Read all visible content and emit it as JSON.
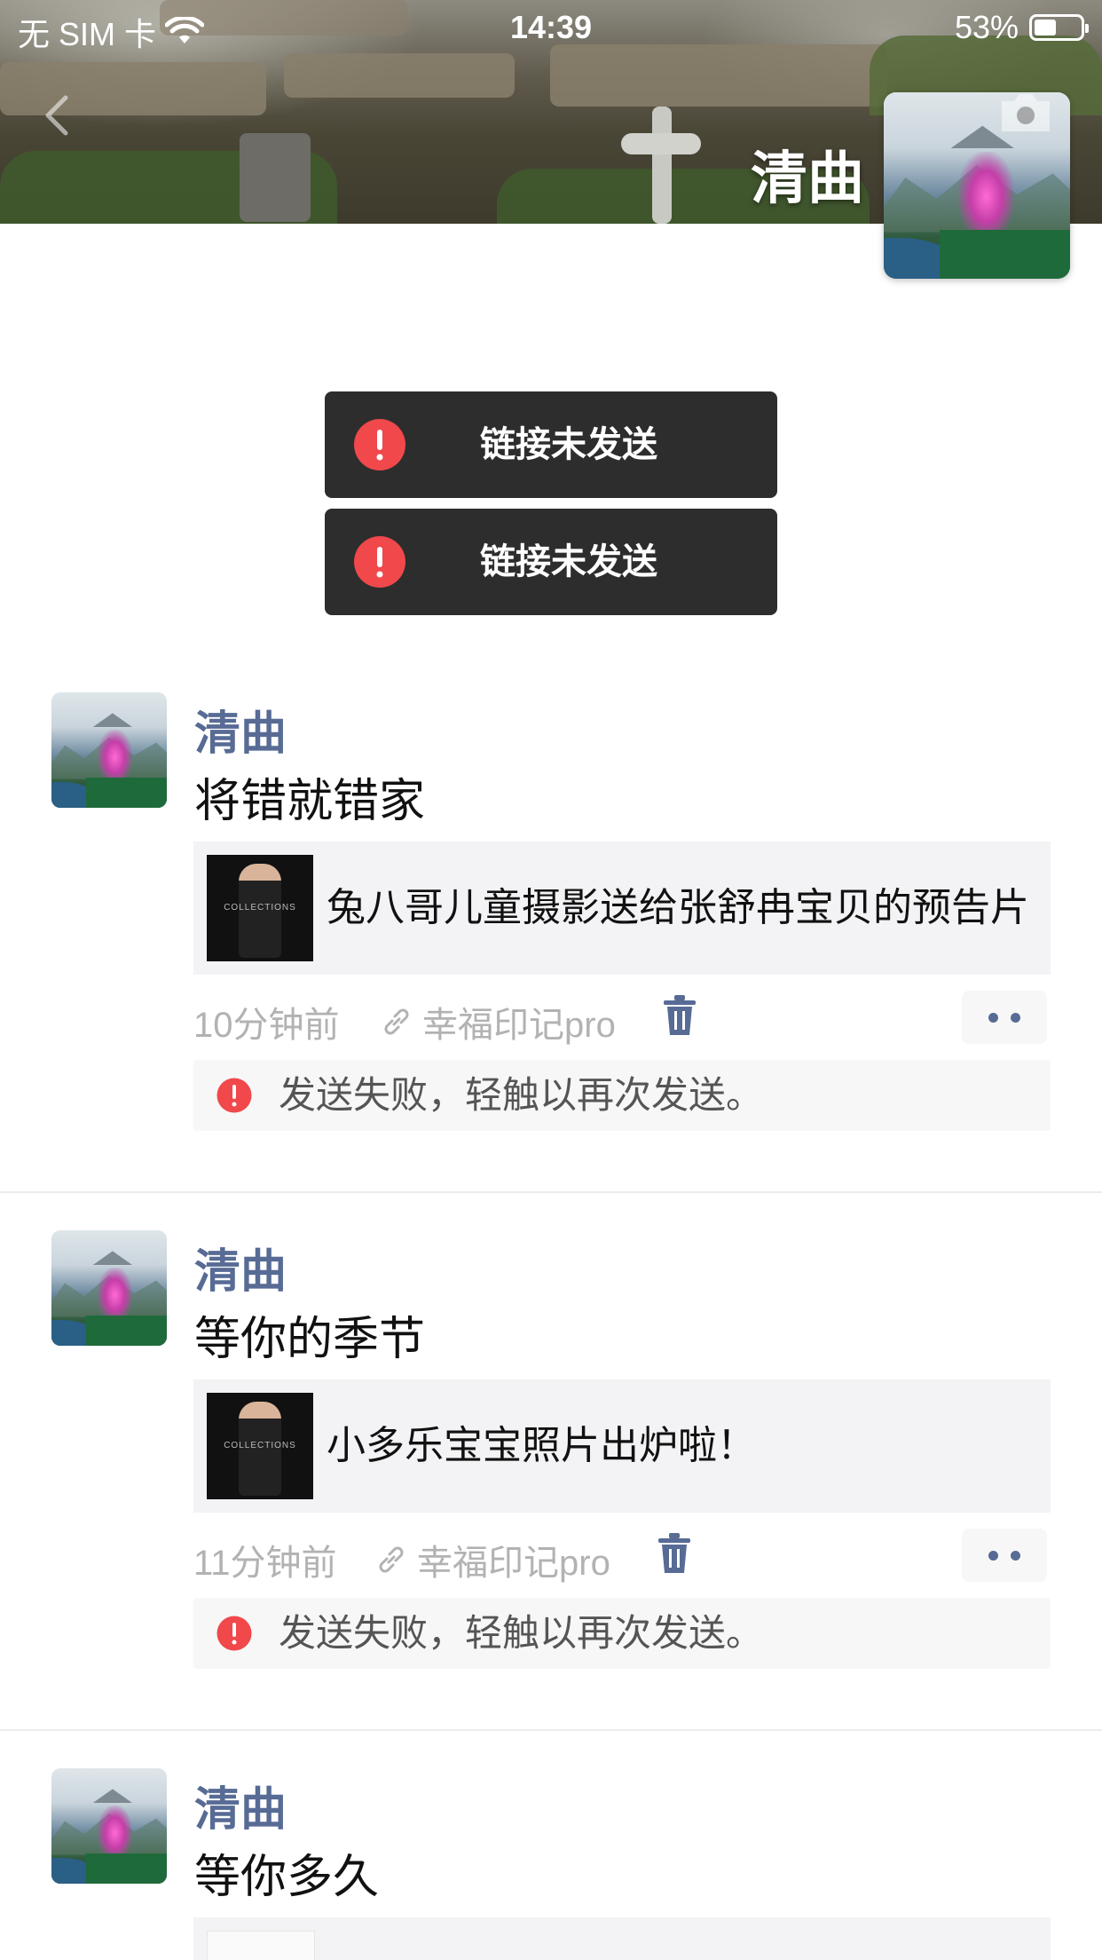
{
  "status_bar": {
    "carrier": "无 SIM 卡",
    "time": "14:39",
    "battery": "53%"
  },
  "cover": {
    "user_name": "清曲"
  },
  "toasts": [
    {
      "text": "链接未发送"
    },
    {
      "text": "链接未发送"
    }
  ],
  "posts": [
    {
      "author": "清曲",
      "text": "将错就错家",
      "link_title": "兔八哥儿童摄影送给张舒冉宝贝的预告片",
      "time": "10分钟前",
      "source": "幸福印记pro",
      "fail_message": "发送失败，轻触以再次发送。"
    },
    {
      "author": "清曲",
      "text": "等你的季节",
      "link_title": "小多乐宝宝照片出炉啦！",
      "time": "11分钟前",
      "source": "幸福印记pro",
      "fail_message": "发送失败，轻触以再次发送。"
    },
    {
      "author": "清曲",
      "text": "等你多久"
    }
  ],
  "thumb_caption": "COLLECTIONS",
  "colors": {
    "name_link": "#576b95",
    "error_red": "#f0484b",
    "toast_bg": "#2d2d2d"
  },
  "icons": [
    "back-icon",
    "wifi-icon",
    "battery-icon",
    "camera-icon",
    "error-icon",
    "link-icon",
    "trash-icon",
    "more-icon"
  ]
}
